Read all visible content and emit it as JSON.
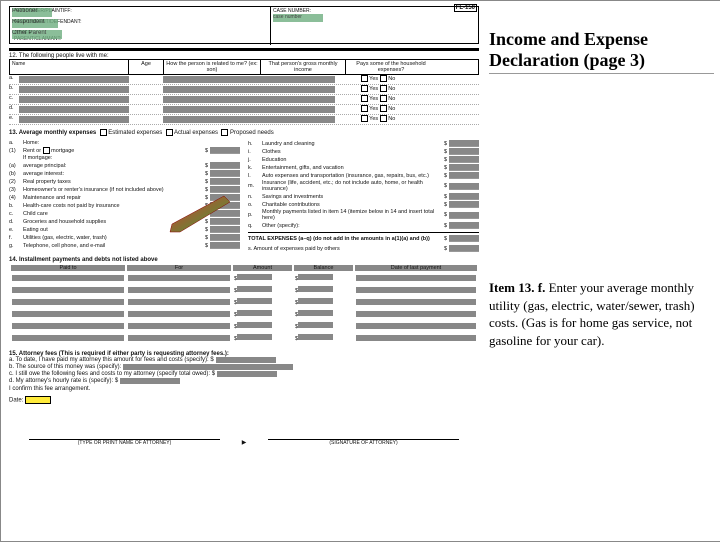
{
  "formCode": "FL-150",
  "header": {
    "petitioner": "PETITIONER/PLAINTIFF:",
    "petVal": "Petitioner",
    "respondent": "RESPONDENT/DEFENDANT:",
    "respVal": "Respondent",
    "other": "OTHER PARENT/CLAIMANT:",
    "otherVal": "Other Parent",
    "caseLbl": "CASE NUMBER:",
    "caseVal": "case number"
  },
  "sec12": {
    "lead": "12.  The following people live with me:",
    "cols": [
      "Name",
      "Age",
      "How the person is related to me? (ex: son)",
      "That person's gross monthly income",
      "Pays some of the household expenses?"
    ],
    "letters": [
      "a.",
      "b.",
      "c.",
      "d.",
      "e."
    ],
    "yes": "Yes",
    "no": "No"
  },
  "sec13": {
    "lead": "13.  Average monthly expenses",
    "opt1": "Estimated expenses",
    "opt2": "Actual expenses",
    "opt3": "Proposed needs",
    "left": [
      {
        "a": "a.",
        "t": "Home:"
      },
      {
        "a": "(1)",
        "t": "Rent or",
        "t2": "mortgage",
        "d": "$"
      },
      {
        "a": "",
        "t": "If mortgage:"
      },
      {
        "a": "(a)",
        "t": "average principal:",
        "d": "$"
      },
      {
        "a": "(b)",
        "t": "average interest:",
        "d": "$"
      },
      {
        "a": "(2)",
        "t": "Real property taxes",
        "d": "$"
      },
      {
        "a": "(3)",
        "t": "Homeowner's or renter's insurance (if not included above)",
        "d": "$"
      },
      {
        "a": "(4)",
        "t": "Maintenance and repair",
        "d": "$"
      },
      {
        "a": "b.",
        "t": "Health-care costs not paid by insurance",
        "d": "$"
      },
      {
        "a": "c.",
        "t": "Child care",
        "d": "$"
      },
      {
        "a": "d.",
        "t": "Groceries and household supplies",
        "d": "$"
      },
      {
        "a": "e.",
        "t": "Eating out",
        "d": "$"
      },
      {
        "a": "f.",
        "t": "Utilities (gas, electric, water, trash)",
        "d": "$"
      },
      {
        "a": "g.",
        "t": "Telephone, cell phone, and e-mail",
        "d": "$"
      }
    ],
    "right": [
      {
        "a": "h.",
        "t": "Laundry and cleaning",
        "d": "$"
      },
      {
        "a": "i.",
        "t": "Clothes",
        "d": "$"
      },
      {
        "a": "j.",
        "t": "Education",
        "d": "$"
      },
      {
        "a": "k.",
        "t": "Entertainment, gifts, and vacation",
        "d": "$"
      },
      {
        "a": "l.",
        "t": "Auto expenses and transportation (insurance, gas, repairs, bus, etc.)",
        "d": "$"
      },
      {
        "a": "m.",
        "t": "Insurance (life, accident, etc.; do not include auto, home, or health insurance)",
        "d": "$"
      },
      {
        "a": "n.",
        "t": "Savings and investments",
        "d": "$"
      },
      {
        "a": "o.",
        "t": "Charitable contributions",
        "d": "$"
      },
      {
        "a": "p.",
        "t": "Monthly payments listed in item 14 (itemize below in 14 and insert total here)",
        "d": "$"
      },
      {
        "a": "q.",
        "t": "Other (specify):",
        "d": "$"
      }
    ],
    "total1": "TOTAL EXPENSES (a–q) (do not add in the amounts in a(1)(a) and (b))",
    "total2": "s.    Amount of expenses paid by others"
  },
  "sec14": {
    "lead": "14.  Installment payments and debts not listed above",
    "cols": [
      "Paid to",
      "For",
      "Amount",
      "Balance",
      "Date of last payment"
    ],
    "dollar": "$"
  },
  "sec15": {
    "lead": "15.  Attorney fees (This is required if either party is requesting attorney fees.):",
    "a": "a.  To date, I have paid my attorney this amount for fees and costs (specify): $",
    "b": "b.  The source of this money was (specify):",
    "c": "c.  I still owe the following fees and costs to my attorney (specify total owed): $",
    "d": "d.  My attorney's hourly rate is (specify): $",
    "conf": "I confirm this fee arrangement.",
    "date": "Date:",
    "sig1": "(TYPE OR PRINT NAME OF ATTORNEY)",
    "sig2": "(SIGNATURE OF ATTORNEY)"
  },
  "slide": {
    "title": "Income and Expense Declaration (page 3)",
    "itemBold": "Item 13. f.",
    "itemText": " Enter your average monthly utility (gas, electric, water/sewer, trash) costs. (Gas is for home gas service, not gasoline for your car)."
  }
}
